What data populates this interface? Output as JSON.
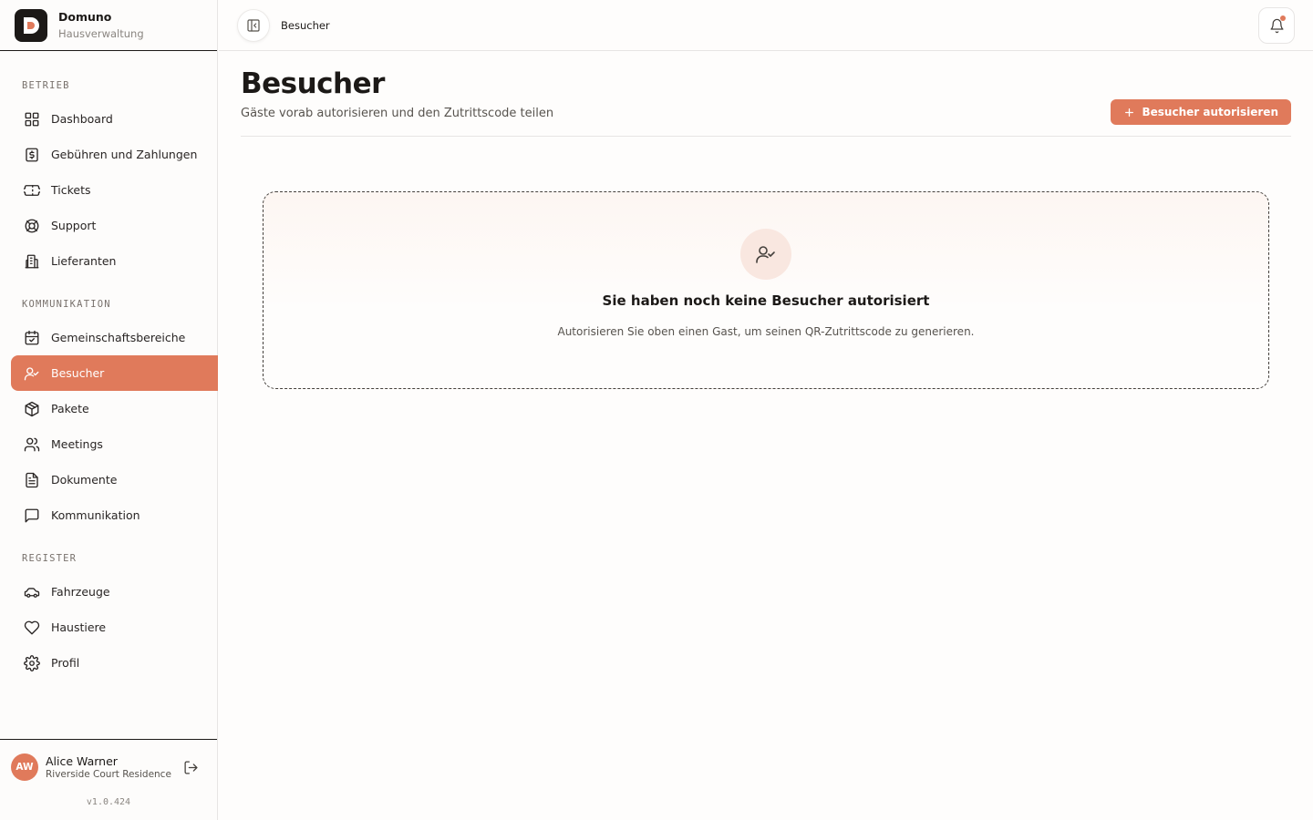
{
  "brand": {
    "name": "Domuno",
    "subtitle": "Hausverwaltung"
  },
  "sections": {
    "operations": "BETRIEB",
    "communication": "KOMMUNIKATION",
    "registry": "REGISTER"
  },
  "nav": {
    "dashboard": "Dashboard",
    "fees": "Gebühren und Zahlungen",
    "tickets": "Tickets",
    "support": "Support",
    "suppliers": "Lieferanten",
    "common_areas": "Gemeinschaftsbereiche",
    "visitors": "Besucher",
    "packages": "Pakete",
    "meetings": "Meetings",
    "documents": "Dokumente",
    "communication": "Kommunikation",
    "vehicles": "Fahrzeuge",
    "pets": "Haustiere",
    "profile": "Profil"
  },
  "active_nav": "visitors",
  "user": {
    "initials": "AW",
    "name": "Alice Warner",
    "residence": "Riverside Court Residence"
  },
  "version": "v1.0.424",
  "header": {
    "breadcrumb": "Besucher"
  },
  "page": {
    "title": "Besucher",
    "subtitle": "Gäste vorab autorisieren und den Zutrittscode teilen",
    "primary_action": "Besucher autorisieren"
  },
  "empty_state": {
    "title": "Sie haben noch keine Besucher autorisiert",
    "description": "Autorisieren Sie oben einen Gast, um seinen QR-Zutrittscode zu generieren."
  },
  "colors": {
    "accent": "#e07a5b",
    "dark": "#1c1917",
    "notification": "#e07a5b"
  }
}
